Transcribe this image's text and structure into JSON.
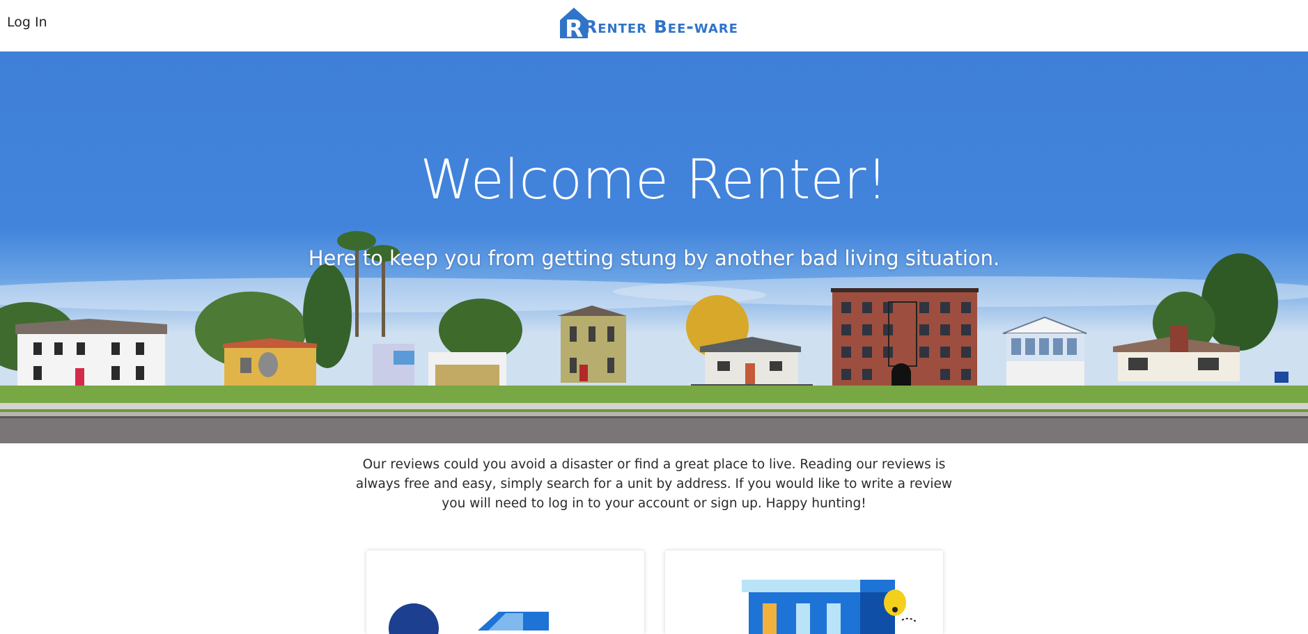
{
  "header": {
    "login_label": "Log In",
    "brand_name": "Renter Bee-ware",
    "brand_color": "#2f74c8"
  },
  "hero": {
    "title": "Welcome Renter!",
    "subtitle": "Here to keep you from getting stung by another bad living situation.",
    "sky_color": "#4284dc"
  },
  "intro": {
    "text": "Our reviews could you avoid a disaster or find a great place to live. Reading our reviews is always free and easy, simply search for a unit by address. If you would like to write a review you will need to log in to your account or sign up. Happy hunting!"
  },
  "cards": [
    {
      "icon": "house-illustration-icon"
    },
    {
      "icon": "building-beehive-illustration-icon"
    }
  ]
}
